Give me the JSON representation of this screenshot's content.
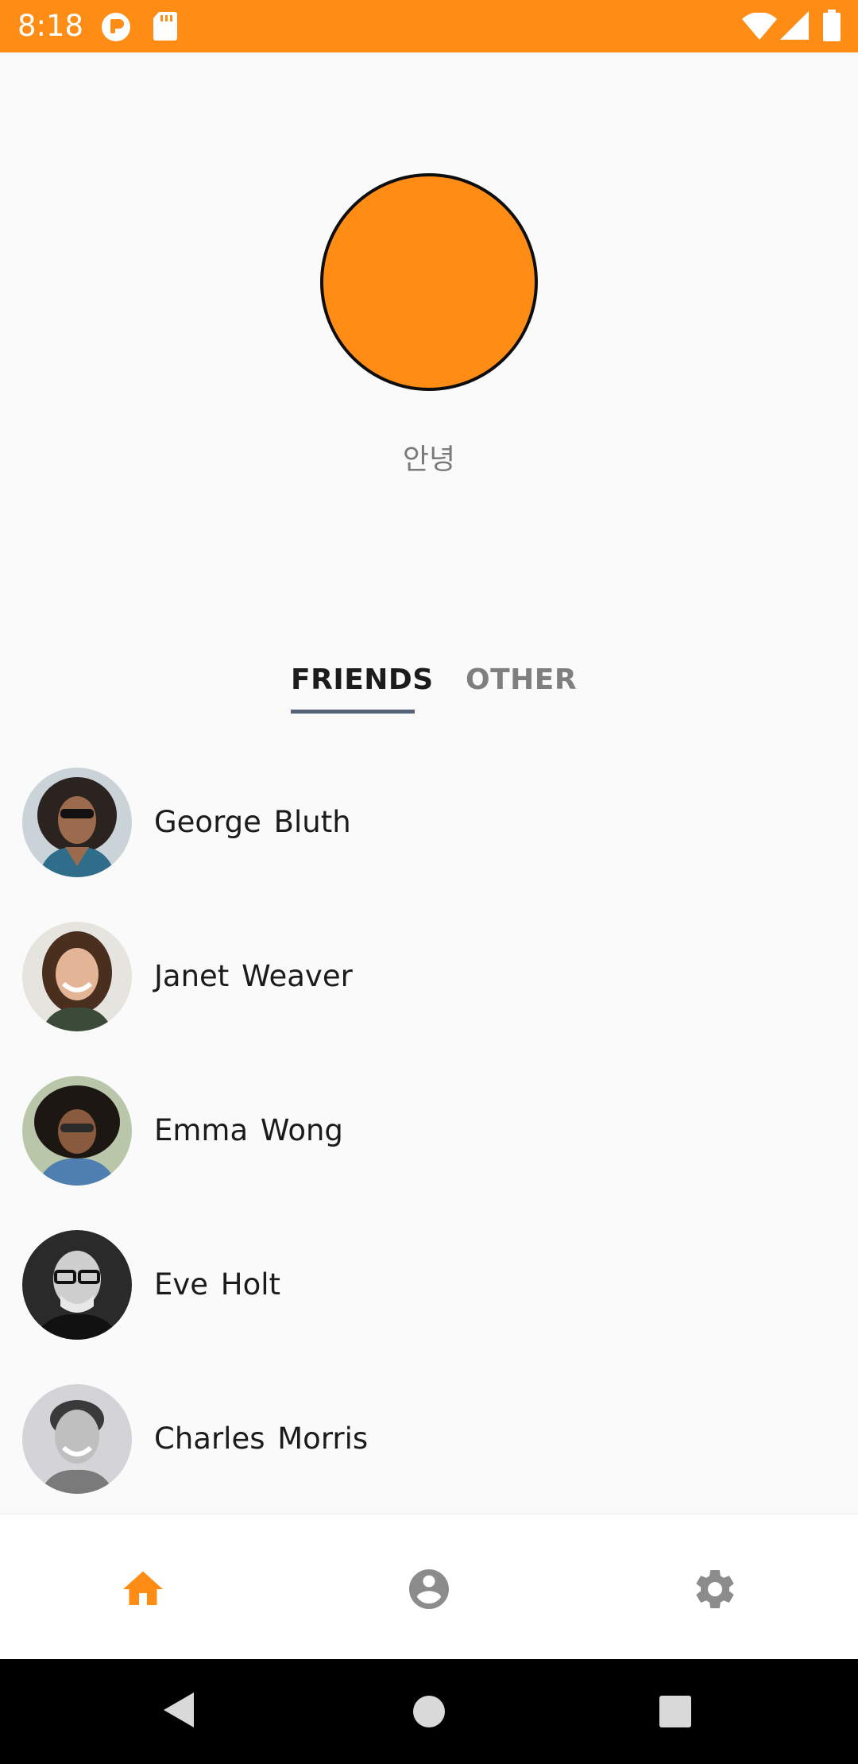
{
  "status_bar": {
    "time": "8:18",
    "background": "#ff8c14",
    "icons": [
      "notification-badge-icon",
      "sd-card-icon",
      "wifi-icon",
      "cell-signal-icon",
      "battery-icon"
    ]
  },
  "profile": {
    "name": "안녕",
    "avatar_color": "#ff8c14"
  },
  "tabs": [
    {
      "label": "FRIENDS",
      "selected": true
    },
    {
      "label": "OTHER",
      "selected": false
    }
  ],
  "friends": [
    {
      "name": "George Bluth"
    },
    {
      "name": "Janet Weaver"
    },
    {
      "name": "Emma Wong"
    },
    {
      "name": "Eve Holt"
    },
    {
      "name": "Charles Morris"
    }
  ],
  "bottom_nav": {
    "items": [
      {
        "icon": "home-icon",
        "active": true
      },
      {
        "icon": "account-circle-icon",
        "active": false
      },
      {
        "icon": "settings-gear-icon",
        "active": false
      }
    ],
    "active_color": "#ff8c14",
    "inactive_color": "#8c8c8c"
  },
  "system_nav": {
    "icons": [
      "back-triangle-icon",
      "home-circle-icon",
      "recents-square-icon"
    ]
  }
}
